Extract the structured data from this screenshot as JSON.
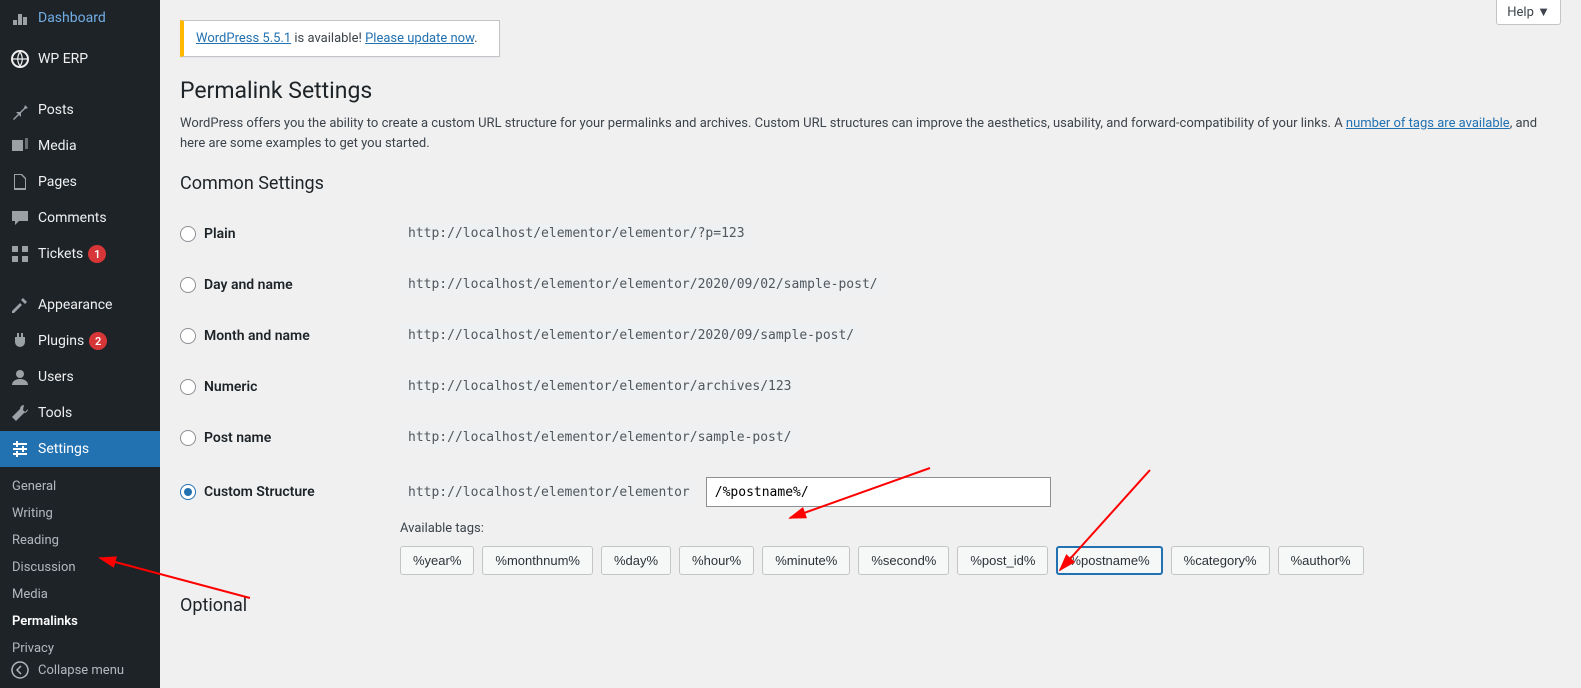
{
  "help": "Help ▼",
  "notice": {
    "a1": "WordPress 5.5.1",
    "mid": " is available! ",
    "a2": "Please update now"
  },
  "page_title": "Permalink Settings",
  "desc_pre": "WordPress offers you the ability to create a custom URL structure for your permalinks and archives. Custom URL structures can improve the aesthetics, usability, and forward-compatibility of your links. A ",
  "desc_link": "number of tags are available",
  "desc_post": ", and here are some examples to get you started.",
  "common_heading": "Common Settings",
  "options": {
    "plain": {
      "label": "Plain",
      "sample": "http://localhost/elementor/elementor/?p=123"
    },
    "day": {
      "label": "Day and name",
      "sample": "http://localhost/elementor/elementor/2020/09/02/sample-post/"
    },
    "month": {
      "label": "Month and name",
      "sample": "http://localhost/elementor/elementor/2020/09/sample-post/"
    },
    "numeric": {
      "label": "Numeric",
      "sample": "http://localhost/elementor/elementor/archives/123"
    },
    "postname": {
      "label": "Post name",
      "sample": "http://localhost/elementor/elementor/sample-post/"
    },
    "custom": {
      "label": "Custom Structure",
      "base": "http://localhost/elementor/elementor",
      "value": "/%postname%/"
    }
  },
  "available_tags_label": "Available tags:",
  "tags": [
    "%year%",
    "%monthnum%",
    "%day%",
    "%hour%",
    "%minute%",
    "%second%",
    "%post_id%",
    "%postname%",
    "%category%",
    "%author%"
  ],
  "optional_heading": "Optional",
  "sidebar": {
    "items": [
      {
        "label": "Dashboard",
        "icon": "dashboard"
      },
      {
        "label": "WP ERP",
        "icon": "erp"
      },
      {
        "label": "Posts",
        "icon": "posts"
      },
      {
        "label": "Media",
        "icon": "media"
      },
      {
        "label": "Pages",
        "icon": "pages"
      },
      {
        "label": "Comments",
        "icon": "comments"
      },
      {
        "label": "Tickets",
        "icon": "tickets",
        "badge": "1"
      },
      {
        "label": "Appearance",
        "icon": "appearance"
      },
      {
        "label": "Plugins",
        "icon": "plugins",
        "badge": "2"
      },
      {
        "label": "Users",
        "icon": "users"
      },
      {
        "label": "Tools",
        "icon": "tools"
      },
      {
        "label": "Settings",
        "icon": "settings"
      }
    ],
    "sub": [
      "General",
      "Writing",
      "Reading",
      "Discussion",
      "Media",
      "Permalinks",
      "Privacy"
    ],
    "collapse": "Collapse menu"
  }
}
